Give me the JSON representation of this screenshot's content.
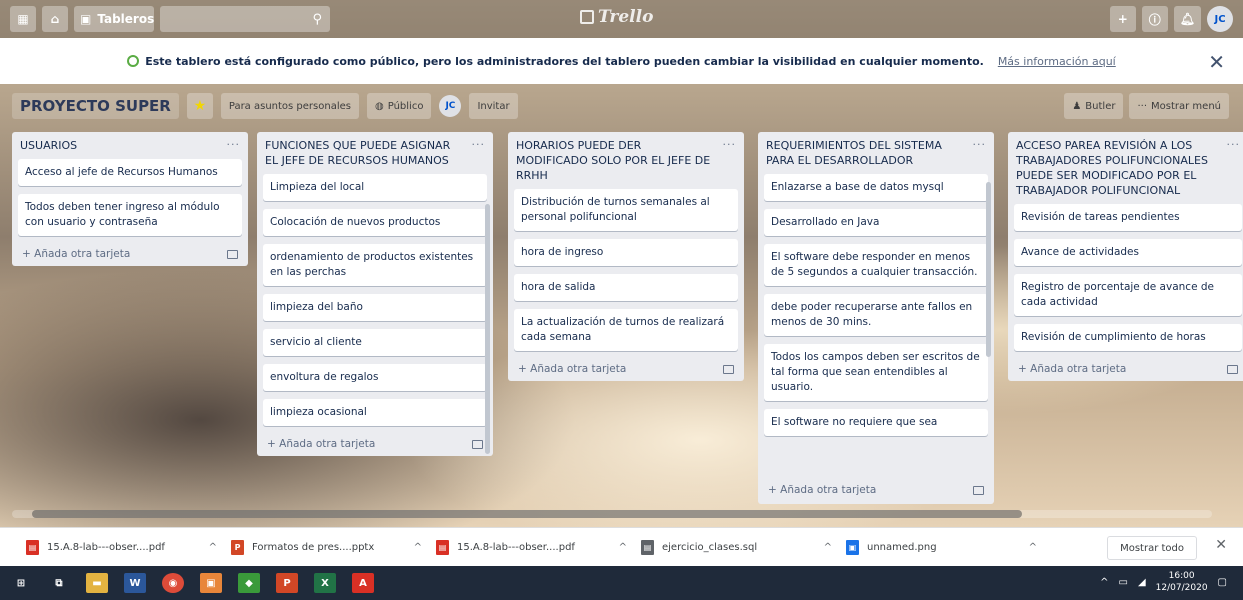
{
  "topbar": {
    "boards_label": "Tableros",
    "logo_text": "Trello",
    "avatar_initials": "JC",
    "icons": [
      "apps-icon",
      "home-icon",
      "board-icon",
      "search-icon",
      "plus-icon",
      "info-icon",
      "bell-icon"
    ]
  },
  "banner": {
    "message": "Este tablero está configurado como público, pero los administradores del tablero pueden cambiar la visibilidad en cualquier momento.",
    "link": "Más información aquí",
    "close": "✕"
  },
  "board": {
    "name": "PROYECTO SUPER",
    "team_label": "Para asuntos personales",
    "visibility_label": "Público",
    "member_initials": "JC",
    "invite_label": "Invitar",
    "butler_label": "Butler",
    "menu_label": "Mostrar menú"
  },
  "lists": [
    {
      "title": "USUARIOS",
      "cards": [
        "Acceso al jefe de Recursos Humanos",
        "Todos deben tener ingreso al módulo con usuario y contraseña"
      ],
      "add_label": "+ Añada otra tarjeta"
    },
    {
      "title": "FUNCIONES QUE PUEDE ASIGNAR EL JEFE DE RECURSOS HUMANOS",
      "cards": [
        "Limpieza del local",
        "Colocación de nuevos productos",
        "ordenamiento de productos existentes en las perchas",
        "limpieza del baño",
        "servicio al cliente",
        "envoltura de regalos",
        "limpieza ocasional"
      ],
      "add_label": "+ Añada otra tarjeta"
    },
    {
      "title": "HORARIOS PUEDE DER MODIFICADO SOLO POR EL JEFE DE RRHH",
      "cards": [
        "Distribución de turnos semanales al personal polifuncional",
        "hora de ingreso",
        "hora de salida",
        "La actualización de turnos de realizará cada semana"
      ],
      "add_label": "+ Añada otra tarjeta"
    },
    {
      "title": "REQUERIMIENTOS DEL SISTEMA PARA EL DESARROLLADOR",
      "cards": [
        "Enlazarse a base de datos mysql",
        "Desarrollado en Java",
        "El software debe responder en menos de 5 segundos a cualquier transacción.",
        "debe poder recuperarse ante fallos en menos de 30 mins.",
        "Todos los campos deben ser escritos de tal forma que sean entendibles al usuario.",
        "El software no requiere que sea"
      ],
      "add_label": "+ Añada otra tarjeta"
    },
    {
      "title": "ACCESO PAREA REVISIÓN A LOS TRABAJADORES POLIFUNCIONALES PUEDE SER MODIFICADO POR EL TRABAJADOR POLIFUNCIONAL",
      "cards": [
        "Revisión de tareas pendientes",
        "Avance de actividades",
        "Registro de porcentaje de avance de cada actividad",
        "Revisión de cumplimiento de horas"
      ],
      "add_label": "+ Añada otra tarjeta"
    }
  ],
  "downloads": {
    "items": [
      {
        "name": "15.A.8-lab---obser....pdf",
        "type": "pdf",
        "color": "#d93025"
      },
      {
        "name": "Formatos de pres....pptx",
        "type": "pptx",
        "color": "#d24726"
      },
      {
        "name": "15.A.8-lab---obser....pdf",
        "type": "pdf",
        "color": "#d93025"
      },
      {
        "name": "ejercicio_clases.sql",
        "type": "sql",
        "color": "#5f6368"
      },
      {
        "name": "unnamed.png",
        "type": "png",
        "color": "#1a73e8"
      }
    ],
    "show_all": "Mostrar todo",
    "close": "✕"
  },
  "taskbar": {
    "time": "16:00",
    "date": "12/07/2020"
  }
}
